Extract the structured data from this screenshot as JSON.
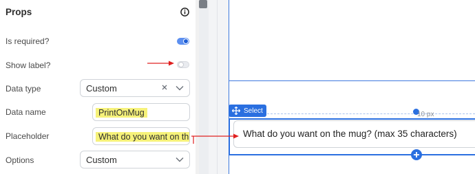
{
  "panel": {
    "title": "Props",
    "rows": {
      "is_required": {
        "label": "Is required?",
        "value": "on"
      },
      "show_label": {
        "label": "Show label?",
        "value": "off"
      },
      "data_type": {
        "label": "Data type",
        "value": "Custom"
      },
      "data_name": {
        "label": "Data name",
        "value": "PrintOnMug"
      },
      "placeholder": {
        "label": "Placeholder",
        "value": "What do you want on the mug? (max 35 characters)"
      },
      "options": {
        "label": "Options",
        "value": "Custom"
      }
    }
  },
  "canvas": {
    "select_badge": "Select",
    "spacing_label": "10 px",
    "input_placeholder": "What do you want on the mug? (max 35 characters)"
  },
  "colors": {
    "accent": "#2a6fe0",
    "annotation_red": "#e02020",
    "highlight_yellow": "#f6f27a"
  },
  "icons": [
    "info-icon",
    "close-icon",
    "chevron-down-icon",
    "move-icon",
    "plus-icon"
  ]
}
